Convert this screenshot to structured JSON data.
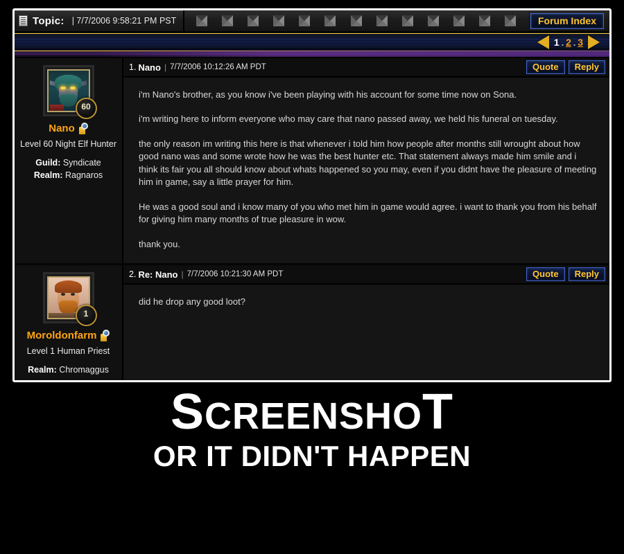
{
  "header": {
    "doc_icon": "document-icon",
    "topic_label": "Topic:",
    "topic_date": "| 7/7/2006 9:58:21 PM PST",
    "ornament_icon": "compass-diamond-icon",
    "ornament_count": 13,
    "forum_index_label": "Forum Index"
  },
  "pagination": {
    "prev_icon": "arrow-left-icon",
    "next_icon": "arrow-right-icon",
    "pages": [
      {
        "label": "1",
        "current": true
      },
      {
        "label": "2",
        "current": false
      },
      {
        "label": "3",
        "current": false
      }
    ],
    "separator": "."
  },
  "posts": [
    {
      "number": "1.",
      "title": "Nano",
      "separator": "|",
      "date": "7/7/2006 10:12:26 AM PDT",
      "quote_label": "Quote",
      "reply_label": "Reply",
      "author": {
        "name": "Nano",
        "level_badge": "60",
        "meta": "Level 60 Night Elf Hunter",
        "guild_label": "Guild:",
        "guild_value": "Syndicate",
        "realm_label": "Realm:",
        "realm_value": "Ragnaros",
        "armory_icon": "armory-search-icon",
        "avatar_icon": "night-elf-portrait"
      },
      "paragraphs": [
        "i'm Nano's brother, as you know i've been playing with his account for some time now on Sona.",
        "i'm writing here to inform everyone who may care that nano passed away, we held his funeral on tuesday.",
        "the only reason im writing this here is that whenever i told him how people after months still wrought about how good nano was and some wrote how he was the best hunter etc. That statement always made him smile and i think its fair you all should know about whats happened so you may, even if you didnt have the pleasure of meeting him in game, say a little prayer for him.",
        "He was a good soul and i know many of you who met him in game would agree. i want to thank you from his behalf for giving him many months of true pleasure in wow.",
        "thank you."
      ]
    },
    {
      "number": "2.",
      "title": "Re: Nano",
      "separator": "|",
      "date": "7/7/2006 10:21:30 AM PDT",
      "quote_label": "Quote",
      "reply_label": "Reply",
      "author": {
        "name": "Moroldonfarm",
        "level_badge": "1",
        "meta": "Level 1 Human Priest",
        "guild_label": "",
        "guild_value": "",
        "realm_label": "Realm:",
        "realm_value": "Chromaggus",
        "armory_icon": "armory-search-icon",
        "avatar_icon": "human-priest-portrait"
      },
      "paragraphs": [
        "did he drop any good loot?"
      ]
    }
  ],
  "caption": {
    "line1_lead": "S",
    "line1_small": "CREENSHO",
    "line1_tail": "T",
    "line2": "OR IT DIDN'T HAPPEN"
  },
  "colors": {
    "gold_text": "#ffc62e",
    "name_orange": "#ffa516",
    "link_orange": "#ff9e0b",
    "button_border_blue": "#4a6bcf",
    "band_gold": "#ffd23a",
    "background": "#000000"
  }
}
